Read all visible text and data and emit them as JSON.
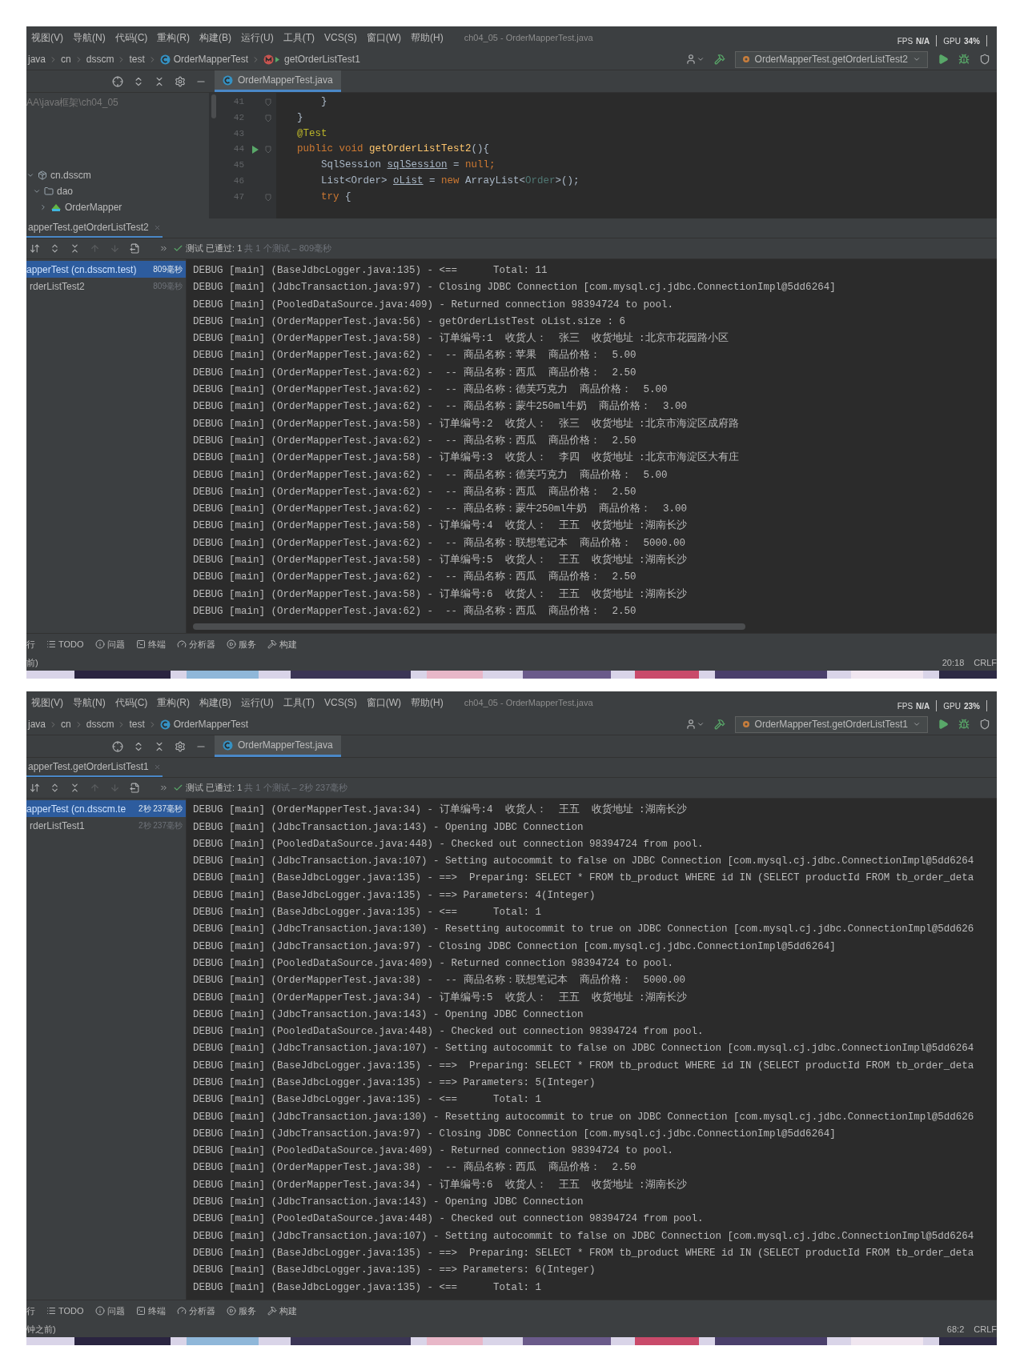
{
  "screens": [
    {
      "menu": [
        "视图(V)",
        "导航(N)",
        "代码(C)",
        "重构(R)",
        "构建(B)",
        "运行(U)",
        "工具(T)",
        "VCS(S)",
        "窗口(W)",
        "帮助(H)"
      ],
      "title": "ch04_05 - OrderMapperTest.java",
      "fps_label": "FPS",
      "fps": "N/A",
      "gpu_label": "GPU",
      "gpu": "34%",
      "breadcrumb": [
        {
          "label": "java",
          "kind": "folder"
        },
        {
          "label": "cn",
          "kind": "folder"
        },
        {
          "label": "dsscm",
          "kind": "folder"
        },
        {
          "label": "test",
          "kind": "folder"
        },
        {
          "label": "OrderMapperTest",
          "kind": "class"
        },
        {
          "label": "getOrderListTest1",
          "kind": "method"
        }
      ],
      "run_config": "OrderMapperTest.getOrderListTest2",
      "editor_tabs": [
        {
          "label": "OrderMapperTest.java",
          "selected": true
        }
      ],
      "project_tree": [
        {
          "label": "AA\\java框架\\ch04_05",
          "kind": "path"
        },
        {
          "label": "cn.dsscm",
          "kind": "package",
          "expanded": true,
          "children": [
            {
              "label": "dao",
              "kind": "folder",
              "expanded": true,
              "children": [
                {
                  "label": "OrderMapper",
                  "kind": "interface",
                  "expanded": false
                }
              ]
            }
          ]
        }
      ],
      "code": [
        {
          "number": "41",
          "kind": "fold",
          "tokens": [
            {
              "text": "    }",
              "kind": "plain"
            }
          ]
        },
        {
          "number": "42",
          "kind": "fold",
          "tokens": [
            {
              "text": "}",
              "kind": "plain"
            }
          ]
        },
        {
          "number": "43",
          "kind": "none",
          "tokens": [
            {
              "text": "@Test",
              "kind": "annotation"
            }
          ]
        },
        {
          "number": "44",
          "kind": "run_fold",
          "tokens": [
            {
              "text": "public void ",
              "kind": "keyword"
            },
            {
              "text": "getOrderListTest2",
              "kind": "method"
            },
            {
              "text": "(){",
              "kind": "plain"
            }
          ]
        },
        {
          "number": "45",
          "kind": "none",
          "tokens": [
            {
              "text": "    SqlSession ",
              "kind": "plain"
            },
            {
              "text": "sqlSession",
              "kind": "var"
            },
            {
              "text": " = ",
              "kind": "plain"
            },
            {
              "text": "null;",
              "kind": "keyword"
            }
          ]
        },
        {
          "number": "46",
          "kind": "none",
          "tokens": [
            {
              "text": "    List<Order> ",
              "kind": "plain"
            },
            {
              "text": "oList",
              "kind": "var"
            },
            {
              "text": " = ",
              "kind": "plain"
            },
            {
              "text": "new",
              "kind": "keyword"
            },
            {
              "text": " ArrayList<",
              "kind": "plain"
            },
            {
              "text": "Order",
              "kind": "type_param"
            },
            {
              "text": ">();",
              "kind": "plain"
            }
          ]
        },
        {
          "number": "47",
          "kind": "fold",
          "tokens": [
            {
              "text": "    try",
              "kind": "keyword"
            },
            {
              "text": " {",
              "kind": "plain"
            }
          ]
        }
      ],
      "run_tab": "apperTest.getOrderListTest2",
      "passed": "测试 已通过: 1",
      "summary": "共 1 个测试 – 809毫秒",
      "test_tree": [
        {
          "label": "apperTest (cn.dsscm.test)",
          "time": "809毫秒",
          "selected": true,
          "children": [
            {
              "label": "rderListTest2",
              "time": "809毫秒",
              "selected": false
            }
          ]
        }
      ],
      "log": [
        "DEBUG [main] (BaseJdbcLogger.java:135) - <==      Total: 11",
        "DEBUG [main] (JdbcTransaction.java:97) - Closing JDBC Connection [com.mysql.cj.jdbc.ConnectionImpl@5dd6264]",
        "DEBUG [main] (PooledDataSource.java:409) - Returned connection 98394724 to pool.",
        "DEBUG [main] (OrderMapperTest.java:56) - getOrderListTest oList.size : 6",
        "DEBUG [main] (OrderMapperTest.java:58) - 订单编号:1  收货人：  张三  收货地址 :北京市花园路小区",
        "DEBUG [main] (OrderMapperTest.java:62) -  -- 商品名称：苹果  商品价格：  5.00",
        "DEBUG [main] (OrderMapperTest.java:62) -  -- 商品名称：西瓜  商品价格：  2.50",
        "DEBUG [main] (OrderMapperTest.java:62) -  -- 商品名称：德芙巧克力  商品价格：  5.00",
        "DEBUG [main] (OrderMapperTest.java:62) -  -- 商品名称：蒙牛250ml牛奶  商品价格：  3.00",
        "DEBUG [main] (OrderMapperTest.java:58) - 订单编号:2  收货人：  张三  收货地址 :北京市海淀区成府路",
        "DEBUG [main] (OrderMapperTest.java:62) -  -- 商品名称：西瓜  商品价格：  2.50",
        "DEBUG [main] (OrderMapperTest.java:58) - 订单编号:3  收货人：  李四  收货地址 :北京市海淀区大有庄",
        "DEBUG [main] (OrderMapperTest.java:62) -  -- 商品名称：德芙巧克力  商品价格：  5.00",
        "DEBUG [main] (OrderMapperTest.java:62) -  -- 商品名称：西瓜  商品价格：  2.50",
        "DEBUG [main] (OrderMapperTest.java:62) -  -- 商品名称：蒙牛250ml牛奶  商品价格：  3.00",
        "DEBUG [main] (OrderMapperTest.java:58) - 订单编号:4  收货人：  王五  收货地址 :湖南长沙",
        "DEBUG [main] (OrderMapperTest.java:62) -  -- 商品名称：联想笔记本  商品价格：  5000.00",
        "DEBUG [main] (OrderMapperTest.java:58) - 订单编号:5  收货人：  王五  收货地址 :湖南长沙",
        "DEBUG [main] (OrderMapperTest.java:62) -  -- 商品名称：西瓜  商品价格：  2.50",
        "DEBUG [main] (OrderMapperTest.java:58) - 订单编号:6  收货人：  王五  收货地址 :湖南长沙",
        "DEBUG [main] (OrderMapperTest.java:62) -  -- 商品名称：西瓜  商品价格：  2.50"
      ],
      "tools": [
        {
          "label": "行",
          "kind": "run"
        },
        {
          "label": "TODO",
          "kind": "todo"
        },
        {
          "label": "问题",
          "kind": "problems"
        },
        {
          "label": "终端",
          "kind": "terminal"
        },
        {
          "label": "分析器",
          "kind": "profiler"
        },
        {
          "label": "服务",
          "kind": "services"
        },
        {
          "label": "构建",
          "kind": "build"
        }
      ],
      "status_left": "前)",
      "status_right": [
        "20:18",
        "CRLF"
      ]
    },
    {
      "menu": [
        "视图(V)",
        "导航(N)",
        "代码(C)",
        "重构(R)",
        "构建(B)",
        "运行(U)",
        "工具(T)",
        "VCS(S)",
        "窗口(W)",
        "帮助(H)"
      ],
      "title": "ch04_05 - OrderMapperTest.java",
      "fps_label": "FPS",
      "fps": "N/A",
      "gpu_label": "GPU",
      "gpu": "23%",
      "breadcrumb": [
        {
          "label": "java",
          "kind": "folder"
        },
        {
          "label": "cn",
          "kind": "folder"
        },
        {
          "label": "dsscm",
          "kind": "folder"
        },
        {
          "label": "test",
          "kind": "folder"
        },
        {
          "label": "OrderMapperTest",
          "kind": "class"
        }
      ],
      "run_config": "OrderMapperTest.getOrderListTest1",
      "editor_tabs": [
        {
          "label": "OrderMapperTest.java",
          "selected": true
        }
      ],
      "run_tab": "apperTest.getOrderListTest1",
      "passed": "测试 已通过: 1",
      "summary": "共 1 个测试 – 2秒 237毫秒",
      "test_tree": [
        {
          "label": "apperTest (cn.dsscm.te",
          "time": "2秒 237毫秒",
          "selected": true,
          "children": [
            {
              "label": "rderListTest1",
              "time": "2秒 237毫秒",
              "selected": false
            }
          ]
        }
      ],
      "log": [
        "DEBUG [main] (OrderMapperTest.java:34) - 订单编号:4  收货人：  王五  收货地址 :湖南长沙",
        "DEBUG [main] (JdbcTransaction.java:143) - Opening JDBC Connection",
        "DEBUG [main] (PooledDataSource.java:448) - Checked out connection 98394724 from pool.",
        "DEBUG [main] (JdbcTransaction.java:107) - Setting autocommit to false on JDBC Connection [com.mysql.cj.jdbc.ConnectionImpl@5dd6264",
        "DEBUG [main] (BaseJdbcLogger.java:135) - ==>  Preparing: SELECT * FROM tb_product WHERE id IN (SELECT productId FROM tb_order_deta",
        "DEBUG [main] (BaseJdbcLogger.java:135) - ==> Parameters: 4(Integer)",
        "DEBUG [main] (BaseJdbcLogger.java:135) - <==      Total: 1",
        "DEBUG [main] (JdbcTransaction.java:130) - Resetting autocommit to true on JDBC Connection [com.mysql.cj.jdbc.ConnectionImpl@5dd626",
        "DEBUG [main] (JdbcTransaction.java:97) - Closing JDBC Connection [com.mysql.cj.jdbc.ConnectionImpl@5dd6264]",
        "DEBUG [main] (PooledDataSource.java:409) - Returned connection 98394724 to pool.",
        "DEBUG [main] (OrderMapperTest.java:38) -  -- 商品名称：联想笔记本  商品价格：  5000.00",
        "DEBUG [main] (OrderMapperTest.java:34) - 订单编号:5  收货人：  王五  收货地址 :湖南长沙",
        "DEBUG [main] (JdbcTransaction.java:143) - Opening JDBC Connection",
        "DEBUG [main] (PooledDataSource.java:448) - Checked out connection 98394724 from pool.",
        "DEBUG [main] (JdbcTransaction.java:107) - Setting autocommit to false on JDBC Connection [com.mysql.cj.jdbc.ConnectionImpl@5dd6264",
        "DEBUG [main] (BaseJdbcLogger.java:135) - ==>  Preparing: SELECT * FROM tb_product WHERE id IN (SELECT productId FROM tb_order_deta",
        "DEBUG [main] (BaseJdbcLogger.java:135) - ==> Parameters: 5(Integer)",
        "DEBUG [main] (BaseJdbcLogger.java:135) - <==      Total: 1",
        "DEBUG [main] (JdbcTransaction.java:130) - Resetting autocommit to true on JDBC Connection [com.mysql.cj.jdbc.ConnectionImpl@5dd626",
        "DEBUG [main] (JdbcTransaction.java:97) - Closing JDBC Connection [com.mysql.cj.jdbc.ConnectionImpl@5dd6264]",
        "DEBUG [main] (PooledDataSource.java:409) - Returned connection 98394724 to pool.",
        "DEBUG [main] (OrderMapperTest.java:38) -  -- 商品名称：西瓜  商品价格：  2.50",
        "DEBUG [main] (OrderMapperTest.java:34) - 订单编号:6  收货人：  王五  收货地址 :湖南长沙",
        "DEBUG [main] (JdbcTransaction.java:143) - Opening JDBC Connection",
        "DEBUG [main] (PooledDataSource.java:448) - Checked out connection 98394724 from pool.",
        "DEBUG [main] (JdbcTransaction.java:107) - Setting autocommit to false on JDBC Connection [com.mysql.cj.jdbc.ConnectionImpl@5dd6264",
        "DEBUG [main] (BaseJdbcLogger.java:135) - ==>  Preparing: SELECT * FROM tb_product WHERE id IN (SELECT productId FROM tb_order_deta",
        "DEBUG [main] (BaseJdbcLogger.java:135) - ==> Parameters: 6(Integer)",
        "DEBUG [main] (BaseJdbcLogger.java:135) - <==      Total: 1"
      ],
      "tools": [
        {
          "label": "行",
          "kind": "run"
        },
        {
          "label": "TODO",
          "kind": "todo"
        },
        {
          "label": "问题",
          "kind": "problems"
        },
        {
          "label": "终端",
          "kind": "terminal"
        },
        {
          "label": "分析器",
          "kind": "profiler"
        },
        {
          "label": "服务",
          "kind": "services"
        },
        {
          "label": "构建",
          "kind": "build"
        }
      ],
      "status_left": "钟之前)",
      "status_right": [
        "68:2",
        "CRLF"
      ]
    }
  ]
}
